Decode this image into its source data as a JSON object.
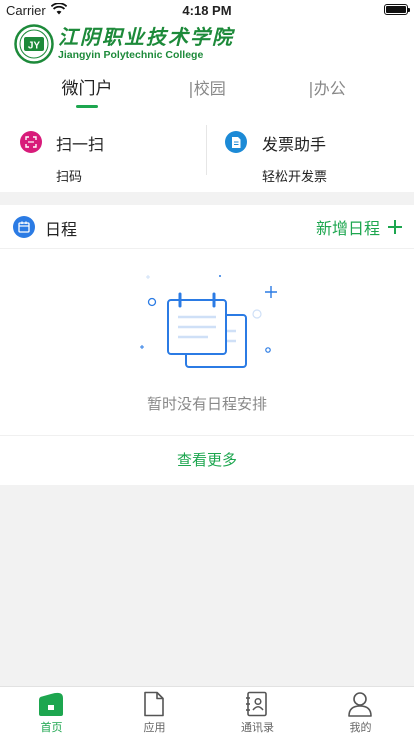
{
  "status_bar": {
    "carrier": "Carrier",
    "time": "4:18 PM"
  },
  "logo": {
    "name_cn": "江阴职业技术学院",
    "name_en": "Jiangyin Polytechnic College"
  },
  "tabs": [
    {
      "label": "微门户",
      "active": true
    },
    {
      "label": "|校园",
      "active": false
    },
    {
      "label": "|办公",
      "active": false
    }
  ],
  "quick_actions": [
    {
      "title": "扫一扫",
      "subtitle": "扫码",
      "icon": "scan-icon",
      "color": "#d81b7a"
    },
    {
      "title": "发票助手",
      "subtitle": "轻松开发票",
      "icon": "invoice-icon",
      "color": "#1c8ad6"
    }
  ],
  "schedule": {
    "title": "日程",
    "add_label": "新增日程",
    "empty_text": "暂时没有日程安排",
    "view_more": "查看更多",
    "icon": "calendar-icon"
  },
  "tabbar": [
    {
      "label": "首页",
      "icon": "home-icon",
      "active": true
    },
    {
      "label": "应用",
      "icon": "document-icon",
      "active": false
    },
    {
      "label": "通讯录",
      "icon": "contacts-icon",
      "active": false
    },
    {
      "label": "我的",
      "icon": "profile-icon",
      "active": false
    }
  ],
  "colors": {
    "accent": "#1da64f",
    "logo_green": "#1d8a3a",
    "schedule_blue": "#2b7be4"
  }
}
